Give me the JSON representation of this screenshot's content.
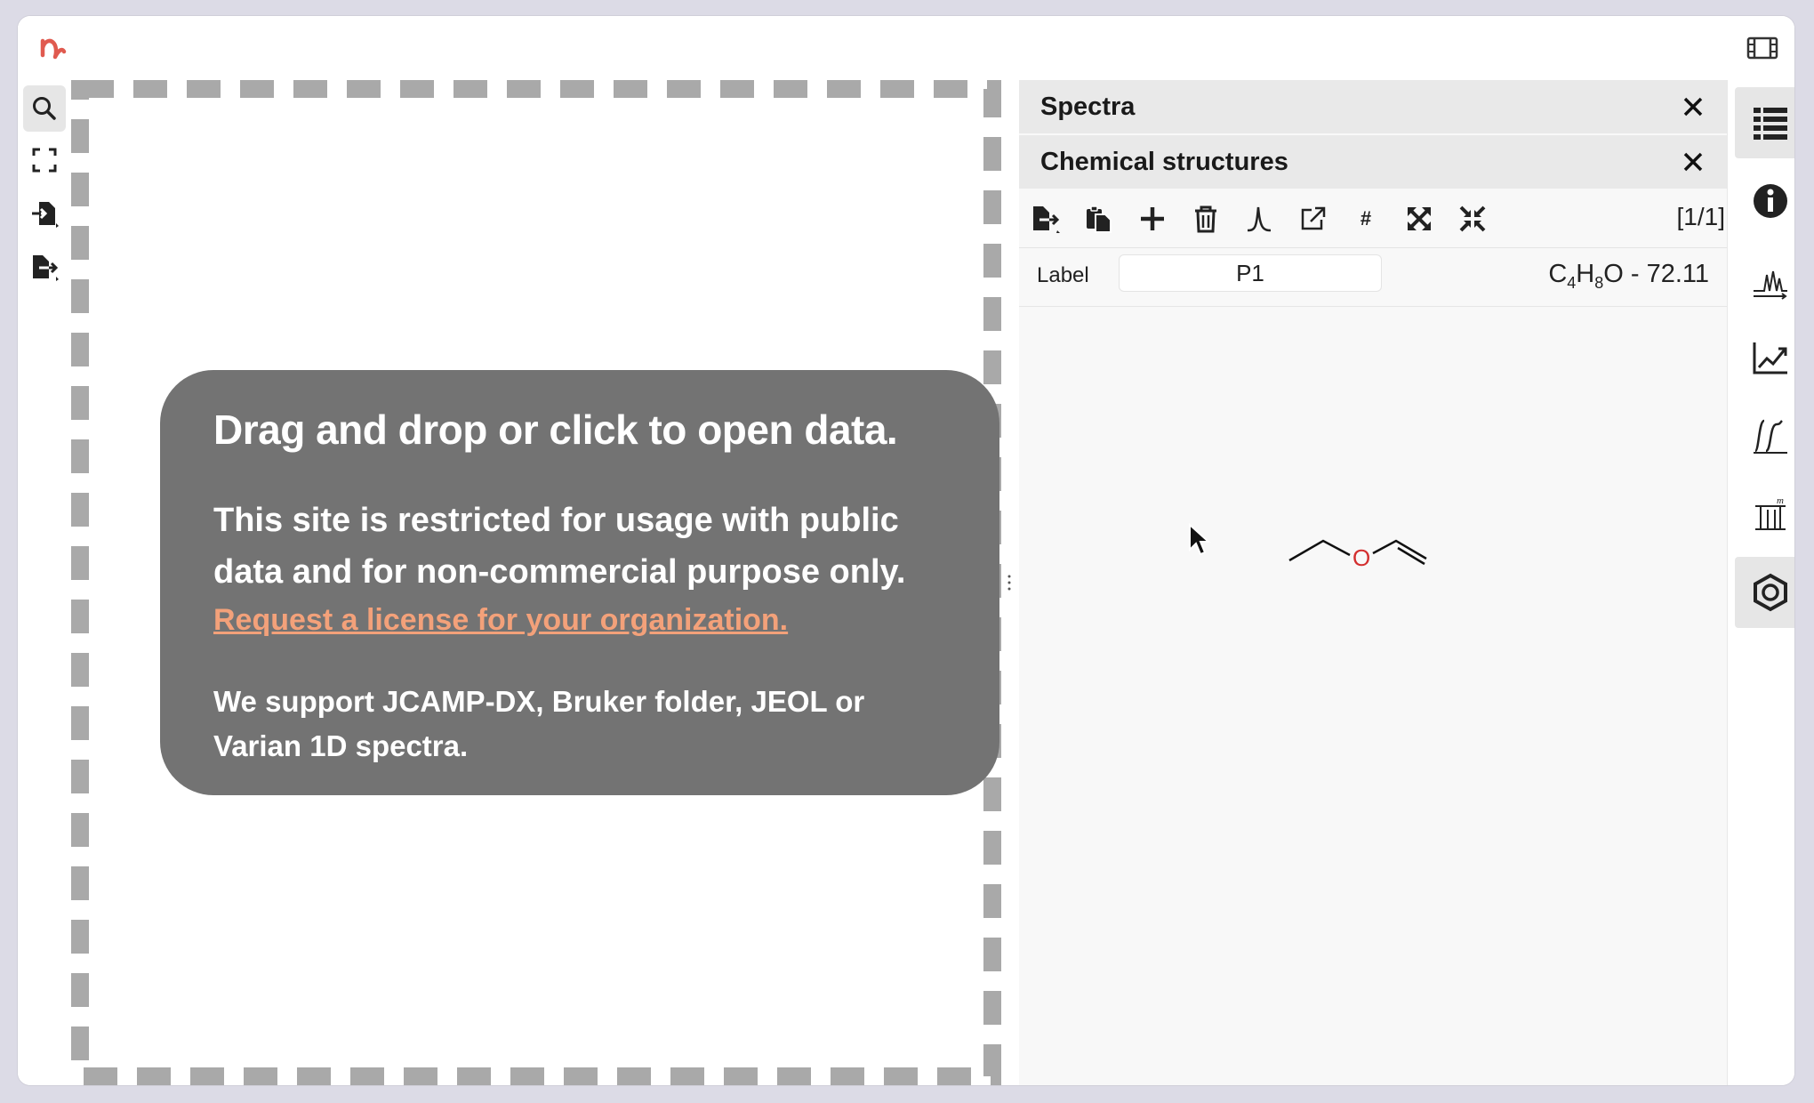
{
  "app": {
    "brand_color": "#e05a4f"
  },
  "left_toolbar": {
    "icons": [
      "search-icon",
      "fullscreen-icon",
      "import-icon",
      "export-icon"
    ]
  },
  "dropzone": {
    "heading": "Drag and drop or click to open data.",
    "notice": "This site is restricted for usage with public data and for non-commercial purpose only.",
    "link_text": "Request a license for your organization.",
    "support_text": "We support JCAMP-DX, Bruker folder, JEOL or Varian 1D spectra.",
    "link_color": "#f3a17a",
    "card_color": "#737373"
  },
  "panels": {
    "spectra": {
      "title": "Spectra",
      "close_glyph": "✕"
    },
    "chemical_structures": {
      "title": "Chemical structures",
      "close_glyph": "✕"
    }
  },
  "structure_toolbar": {
    "counter": "[1/1]",
    "hash_glyph": "#"
  },
  "structure": {
    "label_caption": "Label",
    "label_value": "P1",
    "formula_prefix_c": "C",
    "formula_c_count": "4",
    "formula_h": "H",
    "formula_h_count": "8",
    "formula_rest": "O - 72.11",
    "oxygen_label": "O",
    "oxygen_color": "#d32f2f"
  },
  "right_rail": {
    "icons": [
      "spectra-list-icon",
      "info-icon",
      "peaks-icon",
      "trend-icon",
      "integral-icon",
      "multiplet-icon",
      "structure-icon"
    ]
  }
}
